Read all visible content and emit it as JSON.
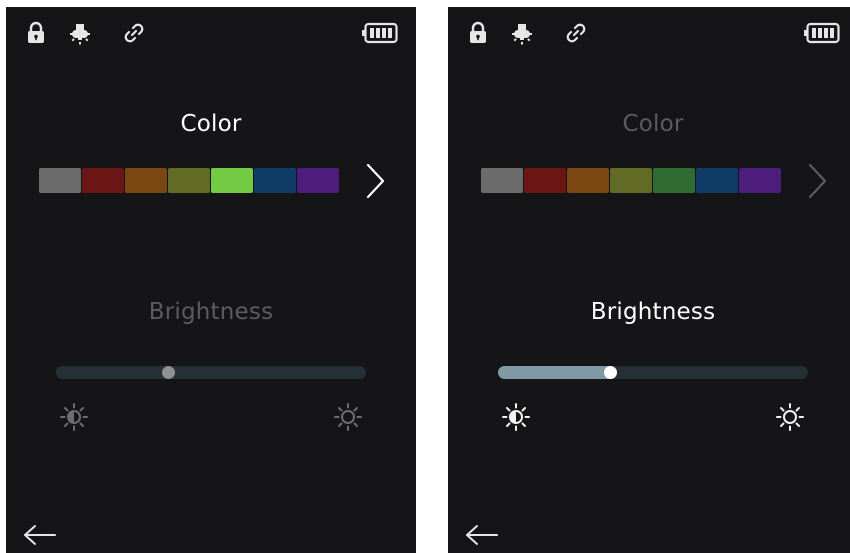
{
  "screens": [
    {
      "color_title": "Color",
      "brightness_title": "Brightness",
      "swatches": [
        "#6b6b6b",
        "#6b1515",
        "#7a4712",
        "#616b25",
        "#74c945",
        "#0f3c66",
        "#4c1d7a"
      ],
      "brightness_level": 0.36,
      "focused": "color",
      "colors": {
        "focused_text": "#ffffff",
        "dim_text": "#5c5c5e",
        "icon": "#e6e6e6",
        "chevron": "#ffffff",
        "slider_fill": "#253036",
        "thumb": "#8f8f8f",
        "sun": "#6d6d6f"
      }
    },
    {
      "color_title": "Color",
      "brightness_title": "Brightness",
      "swatches": [
        "#6b6b6b",
        "#6b1515",
        "#7a4712",
        "#616b25",
        "#2f6b33",
        "#0f3c66",
        "#4c1d7a"
      ],
      "brightness_level": 0.36,
      "focused": "brightness",
      "colors": {
        "focused_text": "#ffffff",
        "dim_text": "#5c5c5e",
        "icon": "#e6e6e6",
        "chevron": "#5c5c5e",
        "slider_fill": "#7f9aa5",
        "thumb": "#ffffff",
        "sun": "#f2f2f2"
      }
    }
  ]
}
